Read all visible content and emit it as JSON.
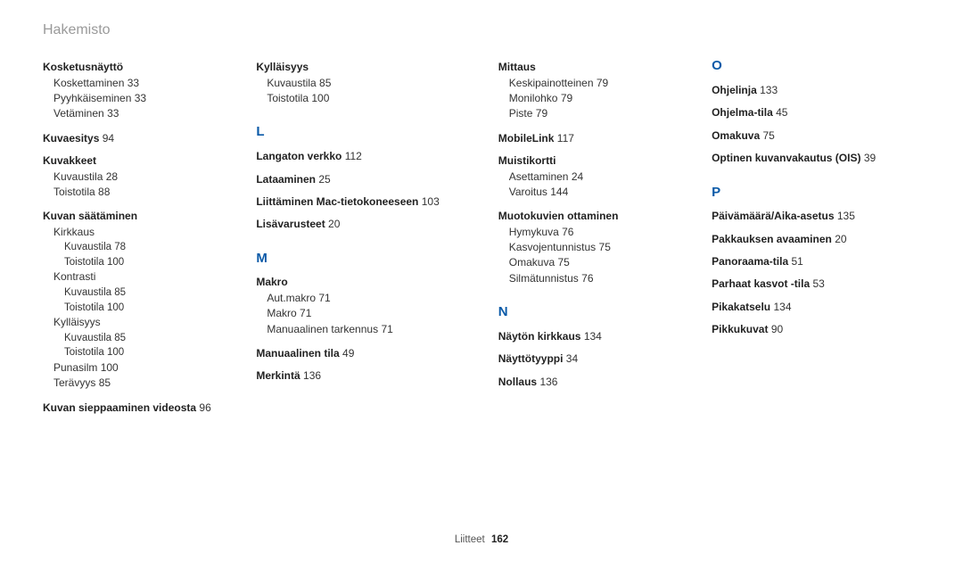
{
  "header": "Hakemisto",
  "footer": {
    "label": "Liitteet",
    "page": "162"
  },
  "col1": {
    "kosketusnaytto": {
      "title": "Kosketusnäyttö",
      "items": [
        {
          "label": "Koskettaminen",
          "page": "33"
        },
        {
          "label": "Pyyhkäiseminen",
          "page": "33"
        },
        {
          "label": "Vetäminen",
          "page": "33"
        }
      ]
    },
    "kuvaesitys": {
      "label": "Kuvaesitys",
      "page": "94"
    },
    "kuvakkeet": {
      "title": "Kuvakkeet",
      "items": [
        {
          "label": "Kuvaustila",
          "page": "28"
        },
        {
          "label": "Toistotila",
          "page": "88"
        }
      ]
    },
    "kuvansaat": {
      "title": "Kuvan säätäminen",
      "groups": [
        {
          "label": "Kirkkaus",
          "items": [
            {
              "label": "Kuvaustila",
              "page": "78"
            },
            {
              "label": "Toistotila",
              "page": "100"
            }
          ]
        },
        {
          "label": "Kontrasti",
          "items": [
            {
              "label": "Kuvaustila",
              "page": "85"
            },
            {
              "label": "Toistotila",
              "page": "100"
            }
          ]
        },
        {
          "label": "Kylläisyys",
          "items": [
            {
              "label": "Kuvaustila",
              "page": "85"
            },
            {
              "label": "Toistotila",
              "page": "100"
            }
          ]
        },
        {
          "label": "Punasilm",
          "page": "100"
        },
        {
          "label": "Terävyys",
          "page": "85"
        }
      ]
    },
    "sieppaaminen": {
      "label": "Kuvan sieppaaminen videosta",
      "page": "96"
    }
  },
  "col2": {
    "kyllaisyys": {
      "title": "Kylläisyys",
      "items": [
        {
          "label": "Kuvaustila",
          "page": "85"
        },
        {
          "label": "Toistotila",
          "page": "100"
        }
      ]
    },
    "L": "L",
    "langaton": {
      "label": "Langaton verkko",
      "page": "112"
    },
    "lataaminen": {
      "label": "Lataaminen",
      "page": "25"
    },
    "liittaminen": {
      "label": "Liittäminen Mac-tietokoneeseen",
      "page": "103"
    },
    "lisavarusteet": {
      "label": "Lisävarusteet",
      "page": "20"
    },
    "M": "M",
    "makro": {
      "title": "Makro",
      "items": [
        {
          "label": "Aut.makro",
          "page": "71"
        },
        {
          "label": "Makro",
          "page": "71"
        },
        {
          "label": "Manuaalinen tarkennus",
          "page": "71"
        }
      ]
    },
    "manuaalinen": {
      "label": "Manuaalinen tila",
      "page": "49"
    },
    "merkinta": {
      "label": "Merkintä",
      "page": "136"
    }
  },
  "col3": {
    "mittaus": {
      "title": "Mittaus",
      "items": [
        {
          "label": "Keskipainotteinen",
          "page": "79"
        },
        {
          "label": "Monilohko",
          "page": "79"
        },
        {
          "label": "Piste",
          "page": "79"
        }
      ]
    },
    "mobilelink": {
      "label": "MobileLink",
      "page": "117"
    },
    "muistikortti": {
      "title": "Muistikortti",
      "items": [
        {
          "label": "Asettaminen",
          "page": "24"
        },
        {
          "label": "Varoitus",
          "page": "144"
        }
      ]
    },
    "muotokuvien": {
      "title": "Muotokuvien ottaminen",
      "items": [
        {
          "label": "Hymykuva",
          "page": "76"
        },
        {
          "label": "Kasvojentunnistus",
          "page": "75"
        },
        {
          "label": "Omakuva",
          "page": "75"
        },
        {
          "label": "Silmätunnistus",
          "page": "76"
        }
      ]
    },
    "N": "N",
    "nayton": {
      "label": "Näytön kirkkaus",
      "page": "134"
    },
    "nayttotyyppi": {
      "label": "Näyttötyyppi",
      "page": "34"
    },
    "nollaus": {
      "label": "Nollaus",
      "page": "136"
    }
  },
  "col4": {
    "O": "O",
    "ohjelinja": {
      "label": "Ohjelinja",
      "page": "133"
    },
    "ohjelmatila": {
      "label": "Ohjelma-tila",
      "page": "45"
    },
    "omakuva": {
      "label": "Omakuva",
      "page": "75"
    },
    "optinen": {
      "label": "Optinen kuvanvakautus (OIS)",
      "page": "39"
    },
    "P": "P",
    "paivamaara": {
      "label": "Päivämäärä/Aika-asetus",
      "page": "135"
    },
    "pakkauksen": {
      "label": "Pakkauksen avaaminen",
      "page": "20"
    },
    "panoraama": {
      "label": "Panoraama-tila",
      "page": "51"
    },
    "parhaat": {
      "label": "Parhaat kasvot -tila",
      "page": "53"
    },
    "pikakatselu": {
      "label": "Pikakatselu",
      "page": "134"
    },
    "pikkukuvat": {
      "label": "Pikkukuvat",
      "page": "90"
    }
  }
}
